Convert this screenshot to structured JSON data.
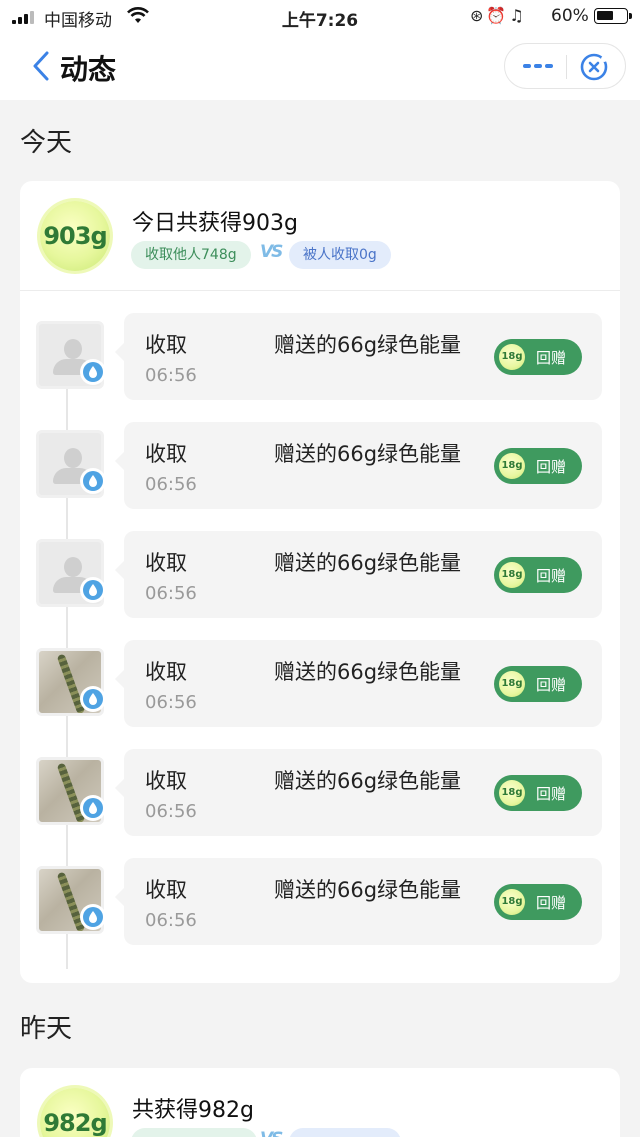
{
  "status_bar": {
    "carrier": "中国移动",
    "time": "上午7:26",
    "battery_percent": "60%"
  },
  "nav": {
    "title": "动态"
  },
  "today": {
    "label": "今天",
    "badge": "903g",
    "title": "今日共获得903g",
    "collected_from_others": "收取他人748g",
    "vs": "VS",
    "collected_by_others": "被人收取0g",
    "entries": [
      {
        "action": "收取",
        "description": "赠送的66g绿色能量",
        "time": "06:56",
        "gift_amount": "18g",
        "gift_label": "回赠"
      },
      {
        "action": "收取",
        "description": "赠送的66g绿色能量",
        "time": "06:56",
        "gift_amount": "18g",
        "gift_label": "回赠"
      },
      {
        "action": "收取",
        "description": "赠送的66g绿色能量",
        "time": "06:56",
        "gift_amount": "18g",
        "gift_label": "回赠"
      },
      {
        "action": "收取",
        "description": "赠送的66g绿色能量",
        "time": "06:56",
        "gift_amount": "18g",
        "gift_label": "回赠"
      },
      {
        "action": "收取",
        "description": "赠送的66g绿色能量",
        "time": "06:56",
        "gift_amount": "18g",
        "gift_label": "回赠"
      },
      {
        "action": "收取",
        "description": "赠送的66g绿色能量",
        "time": "06:56",
        "gift_amount": "18g",
        "gift_label": "回赠"
      }
    ]
  },
  "yesterday": {
    "label": "昨天",
    "badge": "982g",
    "title": "共获得982g",
    "vs": "VS"
  },
  "icons": {
    "back": "chevron-left-icon",
    "more": "more-dots-icon",
    "close": "close-circle-icon",
    "avatar_default": "default-avatar-icon",
    "water_drop": "water-drop-icon"
  },
  "colors": {
    "accent_blue": "#3b82e6",
    "gift_green": "#3f9a5f",
    "badge_green": "#2f7a36"
  }
}
